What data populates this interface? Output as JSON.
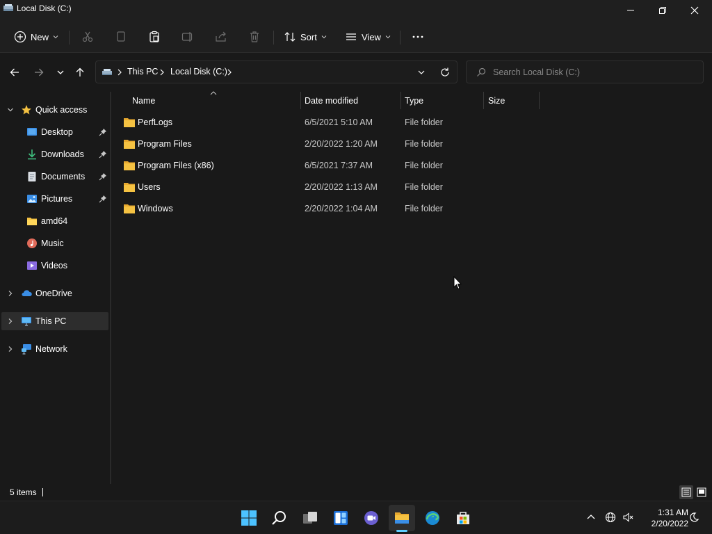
{
  "window": {
    "title": "Local Disk (C:)"
  },
  "toolbar": {
    "new_label": "New",
    "sort_label": "Sort",
    "view_label": "View"
  },
  "address": {
    "crumbs": [
      "This PC",
      "Local Disk (C:)"
    ]
  },
  "search": {
    "placeholder": "Search Local Disk (C:)"
  },
  "sidebar": {
    "items": [
      {
        "label": "Quick access",
        "icon": "star-icon"
      },
      {
        "label": "Desktop",
        "icon": "desktop-icon",
        "pinned": true
      },
      {
        "label": "Downloads",
        "icon": "download-icon",
        "pinned": true
      },
      {
        "label": "Documents",
        "icon": "document-icon",
        "pinned": true
      },
      {
        "label": "Pictures",
        "icon": "pictures-icon",
        "pinned": true
      },
      {
        "label": "amd64",
        "icon": "folder-icon"
      },
      {
        "label": "Music",
        "icon": "music-icon"
      },
      {
        "label": "Videos",
        "icon": "videos-icon"
      },
      {
        "label": "OneDrive",
        "icon": "cloud-icon"
      },
      {
        "label": "This PC",
        "icon": "monitor-icon",
        "selected": true
      },
      {
        "label": "Network",
        "icon": "network-icon"
      }
    ]
  },
  "columns": {
    "name": "Name",
    "date": "Date modified",
    "type": "Type",
    "size": "Size"
  },
  "files": [
    {
      "name": "PerfLogs",
      "date": "6/5/2021 5:10 AM",
      "type": "File folder"
    },
    {
      "name": "Program Files",
      "date": "2/20/2022 1:20 AM",
      "type": "File folder"
    },
    {
      "name": "Program Files (x86)",
      "date": "6/5/2021 7:37 AM",
      "type": "File folder"
    },
    {
      "name": "Users",
      "date": "2/20/2022 1:13 AM",
      "type": "File folder"
    },
    {
      "name": "Windows",
      "date": "2/20/2022 1:04 AM",
      "type": "File folder"
    }
  ],
  "status": {
    "item_count": "5 items"
  },
  "clock": {
    "time": "1:31 AM",
    "date": "2/20/2022"
  },
  "colors": {
    "folder": "#f5c242",
    "accent": "#60cdff",
    "background": "#191919"
  }
}
